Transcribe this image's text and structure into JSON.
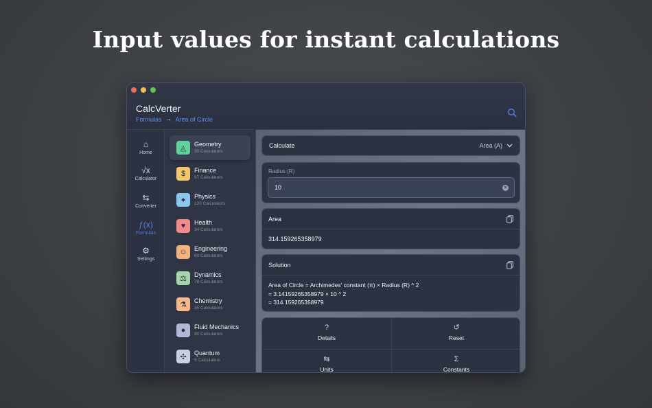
{
  "headline": "Input values for instant calculations",
  "app": {
    "title": "CalcVerter",
    "breadcrumb": {
      "root": "Formulas",
      "separator": "→",
      "current": "Area of Circle"
    }
  },
  "rail": [
    {
      "label": "Home",
      "icon": "home-icon",
      "glyph": "⌂",
      "active": false
    },
    {
      "label": "Calculator",
      "icon": "sqrt-icon",
      "glyph": "√x",
      "active": false
    },
    {
      "label": "Converter",
      "icon": "swap-arrows-icon",
      "glyph": "⇆",
      "active": false
    },
    {
      "label": "Formulas",
      "icon": "function-icon",
      "glyph": "ƒ(x)",
      "active": true
    },
    {
      "label": "Settings",
      "icon": "gear-icon",
      "glyph": "⚙",
      "active": false
    }
  ],
  "categories": [
    {
      "name": "Geometry",
      "count": "30 Calculators",
      "icon": "geometry-icon",
      "glyph": "◬",
      "color": "#5fd39a",
      "active": true
    },
    {
      "name": "Finance",
      "count": "97 Calculators",
      "icon": "money-bag-icon",
      "glyph": "$",
      "color": "#f3c969",
      "active": false
    },
    {
      "name": "Physics",
      "count": "120 Calculators",
      "icon": "lightbulb-icon",
      "glyph": "✦",
      "color": "#8cc7f2",
      "active": false
    },
    {
      "name": "Health",
      "count": "34 Calculators",
      "icon": "heart-icon",
      "glyph": "♥",
      "color": "#f28a8a",
      "active": false
    },
    {
      "name": "Engineering",
      "count": "60 Calculators",
      "icon": "engineer-icon",
      "glyph": "☺",
      "color": "#f2b27a",
      "active": false
    },
    {
      "name": "Dynamics",
      "count": "78 Calculators",
      "icon": "pendulum-icon",
      "glyph": "⚖",
      "color": "#a5d6a7",
      "active": false
    },
    {
      "name": "Chemistry",
      "count": "35 Calculators",
      "icon": "flask-icon",
      "glyph": "⚗",
      "color": "#f5b98a",
      "active": false
    },
    {
      "name": "Fluid Mechanics",
      "count": "90 Calculators",
      "icon": "droplet-icon",
      "glyph": "●",
      "color": "#b3b8d8",
      "active": false
    },
    {
      "name": "Quantum",
      "count": "5 Calculators",
      "icon": "atom-icon",
      "glyph": "✣",
      "color": "#c9d0e0",
      "active": false
    }
  ],
  "calculate": {
    "label": "Calculate",
    "selected": "Area (A)"
  },
  "input": {
    "label": "Radius (R)",
    "value": "10"
  },
  "result": {
    "title": "Area",
    "value": "314.159265358979"
  },
  "solution": {
    "title": "Solution",
    "lines": [
      "Area of Circle = Archimedes' constant (π) × Radius (R) ^ 2",
      "= 3.14159265358979 × 10 ^ 2",
      "= 314.159265358979"
    ]
  },
  "actions": [
    {
      "label": "Details",
      "icon": "question-icon",
      "glyph": "?"
    },
    {
      "label": "Reset",
      "icon": "reset-icon",
      "glyph": "↺"
    },
    {
      "label": "Units",
      "icon": "swap-arrows-icon",
      "glyph": "⇆"
    },
    {
      "label": "Constants",
      "icon": "sigma-icon",
      "glyph": "Σ"
    }
  ],
  "colors": {
    "accent": "#4f7fe8",
    "link": "#5b8ff0"
  }
}
